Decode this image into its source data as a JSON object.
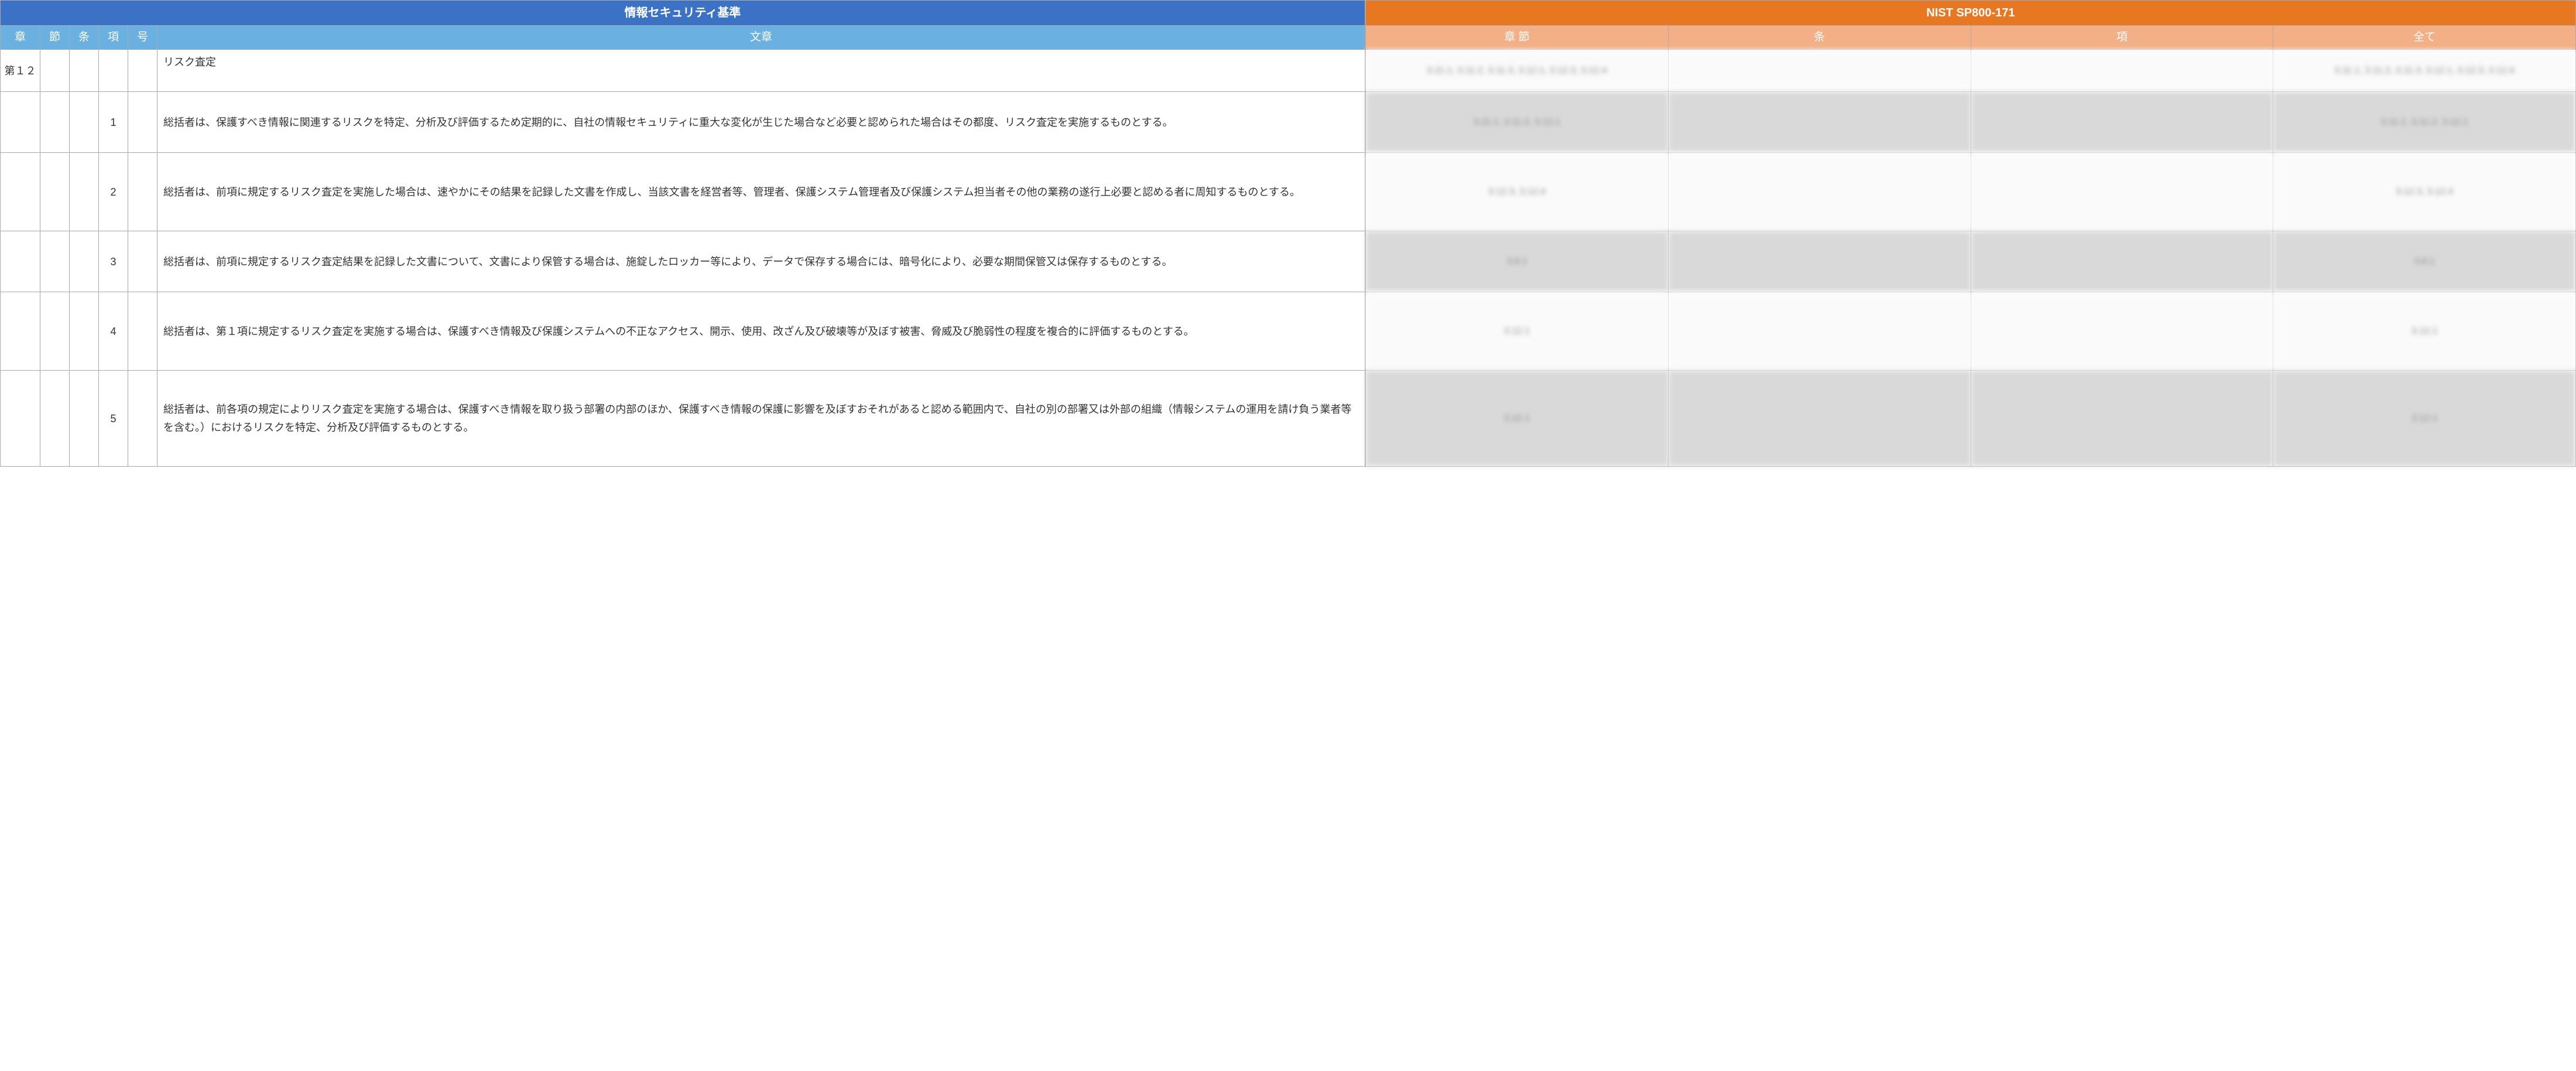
{
  "left": {
    "title": "情報セキュリティ基準",
    "headers": {
      "chapter": "章",
      "section": "節",
      "article": "条",
      "item": "項",
      "number": "号",
      "text": "文章"
    },
    "rows": [
      {
        "chapter": "第１２",
        "section": "",
        "article": "",
        "item": "",
        "number": "",
        "text": "リスク査定"
      },
      {
        "chapter": "",
        "section": "",
        "article": "",
        "item": "1",
        "number": "",
        "text": "総括者は、保護すべき情報に関連するリスクを特定、分析及び評価するため定期的に、自社の情報セキュリティに重大な変化が生じた場合など必要と認められた場合はその都度、リスク査定を実施するものとする。"
      },
      {
        "chapter": "",
        "section": "",
        "article": "",
        "item": "2",
        "number": "",
        "text": "総括者は、前項に規定するリスク査定を実施した場合は、速やかにその結果を記録した文書を作成し、当該文書を経営者等、管理者、保護システム管理者及び保護システム担当者その他の業務の遂行上必要と認める者に周知するものとする。"
      },
      {
        "chapter": "",
        "section": "",
        "article": "",
        "item": "3",
        "number": "",
        "text": "総括者は、前項に規定するリスク査定結果を記録した文書について、文書により保管する場合は、施錠したロッカー等により、データで保存する場合には、暗号化により、必要な期間保管又は保存するものとする。"
      },
      {
        "chapter": "",
        "section": "",
        "article": "",
        "item": "4",
        "number": "",
        "text": "総括者は、第１項に規定するリスク査定を実施する場合は、保護すべき情報及び保護システムへの不正なアクセス、開示、使用、改ざん及び破壊等が及ぼす被害、脅威及び脆弱性の程度を複合的に評価するものとする。"
      },
      {
        "chapter": "",
        "section": "",
        "article": "",
        "item": "5",
        "number": "",
        "text": "総括者は、前各項の規定によりリスク査定を実施する場合は、保護すべき情報を取り扱う部署の内部のほか、保護すべき情報の保護に影響を及ぼすおそれがあると認める範囲内で、自社の別の部署又は外部の組織（情報システムの運用を請け負う業者等を含む。）におけるリスクを特定、分析及び評価するものとする。"
      }
    ]
  },
  "right": {
    "title": "NIST SP800-171",
    "headers": {
      "chap_sec": "章 節",
      "article": "条",
      "item": "項",
      "all": "全て"
    },
    "rows": [
      {
        "chap_sec": "3.11.1, 3.11.2, 3.11.3, 3.12.1, 3.12.3, 3.12.4",
        "article": "",
        "item": "",
        "all": "3.11.1, 3.11.2, 3.11.3, 3.12.1, 3.12.3, 3.12.4"
      },
      {
        "chap_sec": "3.11.1, 3.11.2, 3.12.1",
        "article": "",
        "item": "",
        "all": "3.11.1, 3.11.2, 3.12.1"
      },
      {
        "chap_sec": "3.12.3, 3.12.4",
        "article": "",
        "item": "",
        "all": "3.12.3, 3.12.4"
      },
      {
        "chap_sec": "3.8.1",
        "article": "",
        "item": "",
        "all": "3.8.1"
      },
      {
        "chap_sec": "3.12.1",
        "article": "",
        "item": "",
        "all": "3.12.1"
      },
      {
        "chap_sec": "3.12.1",
        "article": "",
        "item": "",
        "all": "3.12.1"
      }
    ]
  }
}
